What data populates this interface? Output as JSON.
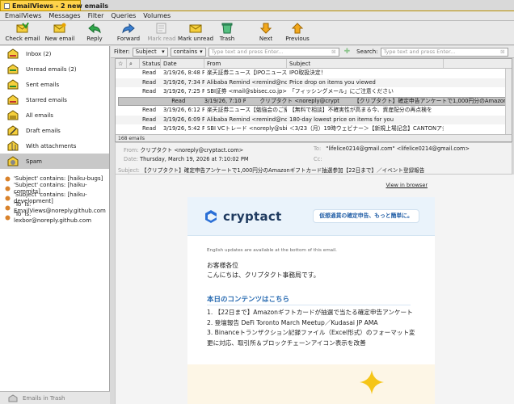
{
  "window": {
    "title": "EmailViews - 2 new emails"
  },
  "menu": [
    "EmailViews",
    "Messages",
    "Filter",
    "Queries",
    "Volumes"
  ],
  "toolbar": {
    "check_email": "Check email",
    "new_email": "New email",
    "reply": "Reply",
    "forward": "Forward",
    "mark_read": "Mark read",
    "mark_unread": "Mark unread",
    "trash": "Trash",
    "next": "Next",
    "previous": "Previous"
  },
  "sidebar": {
    "folders": [
      {
        "label": "Inbox (2)",
        "icon": "inbox-icon"
      },
      {
        "label": "Unread emails (2)",
        "icon": "unread-icon"
      },
      {
        "label": "Sent emails",
        "icon": "sent-icon"
      },
      {
        "label": "Starred emails",
        "icon": "star-icon"
      },
      {
        "label": "All emails",
        "icon": "all-emails-icon"
      },
      {
        "label": "Draft emails",
        "icon": "draft-icon"
      },
      {
        "label": "With attachments",
        "icon": "attachment-icon"
      },
      {
        "label": "Spam",
        "icon": "spam-icon"
      }
    ],
    "queries": [
      "'Subject' contains: [haiku-bugs]",
      "'Subject' contains: [haiku-commits]",
      "'Subject' contains: [haiku-development]",
      "'To' is: EmailViews@noreply.github.com",
      "'To' is: lexbor@noreply.github.com"
    ],
    "footer": "Emails in Trash"
  },
  "filterbar": {
    "filter_label": "Filter:",
    "field": "Subject",
    "operator": "contains",
    "filter_placeholder": "Type text and press Enter...",
    "search_label": "Search:",
    "search_placeholder": "Type text and press Enter..."
  },
  "list": {
    "columns": {
      "status": "Status",
      "date": "Date",
      "from": "From",
      "subject": "Subject"
    },
    "rows": [
      {
        "status": "Read",
        "date": "3/19/26, 8:48 PM",
        "from": "楽天証券ニュース【IPOニュース...",
        "subject": "IPO取扱決定！",
        "selected": false
      },
      {
        "status": "Read",
        "date": "3/19/26, 7:34 PM",
        "from": "Alibaba Remind <remind@notice...",
        "subject": "Price drop on items you viewed",
        "selected": false
      },
      {
        "status": "Read",
        "date": "3/19/26, 7:25 PM",
        "from": "SBI証券 <mail@sbisec.co.jp>",
        "subject": "「フィッシングメール」にご注意ください",
        "selected": false
      },
      {
        "status": "Read",
        "date": "3/19/26, 7:10 PM",
        "from": "クリプタクト <noreply@cryptact...",
        "subject": "【クリプタクト】確定申告アンケートで1,000円分のAmazonギフト...",
        "selected": true
      },
      {
        "status": "Read",
        "date": "3/19/26, 6:12 PM",
        "from": "楽天証券ニュース【勉強会のご案...",
        "subject": "【無料で相談】不確実性が高まる今、資産配分の再点検を",
        "selected": false
      },
      {
        "status": "Read",
        "date": "3/19/26, 6:09 PM",
        "from": "Alibaba Remind <remind@notice...",
        "subject": "180-day lowest price on items for you",
        "selected": false
      },
      {
        "status": "Read",
        "date": "3/19/26, 5:42 PM",
        "from": "SBI VCトレード <noreply@sbivc.c...",
        "subject": "＜3/23（月）19時ウェビナー＞【新規上場記念】CANTONアジア担...",
        "selected": false
      }
    ],
    "count": "168 emails"
  },
  "header": {
    "from_label": "From:",
    "from": "クリプタクト <noreply@cryptact.com>",
    "to_label": "To:",
    "to": "\"lifelice0214@gmail.com\" <lifelice0214@gmail.com>",
    "date_label": "Date:",
    "date": "Thursday, March 19, 2026 at 7:10:02 PM",
    "cc_label": "Cc:",
    "subject_label": "Subject:",
    "subject": "【クリプタクト】確定申告アンケートで1,000円分のAmazonギフトカード抽選参加【22日まで】／イベント登録報告"
  },
  "body": {
    "view_in_browser": "View in browser",
    "logo_text": "cryptact",
    "tagline": "仮想通貨の確定申告、もっと簡単に。",
    "english_note": "English updates are available at the bottom of this email.",
    "greeting_1": "お客様各位",
    "greeting_2": "こんにちは、クリプタクト事務局です。",
    "contents_title": "本日のコンテンツはこちら",
    "items": [
      "1. 【22日まで】Amazonギフトカードが抽選で当たる確定申告アンケート",
      "2. 登壇報告 DeFi Toronto March Meetup／Kudasai JP AMA",
      "3. Binanceトランザクション記録ファイル（Excel形式）のフォーマット変更に対応、取引所＆ブロックチェーンアイコン表示を改善"
    ]
  },
  "colors": {
    "title_bar": "#ffd34a",
    "selection": "#c4c4c4",
    "brand": "#1f3a5f",
    "accent_blue": "#2468b0"
  }
}
